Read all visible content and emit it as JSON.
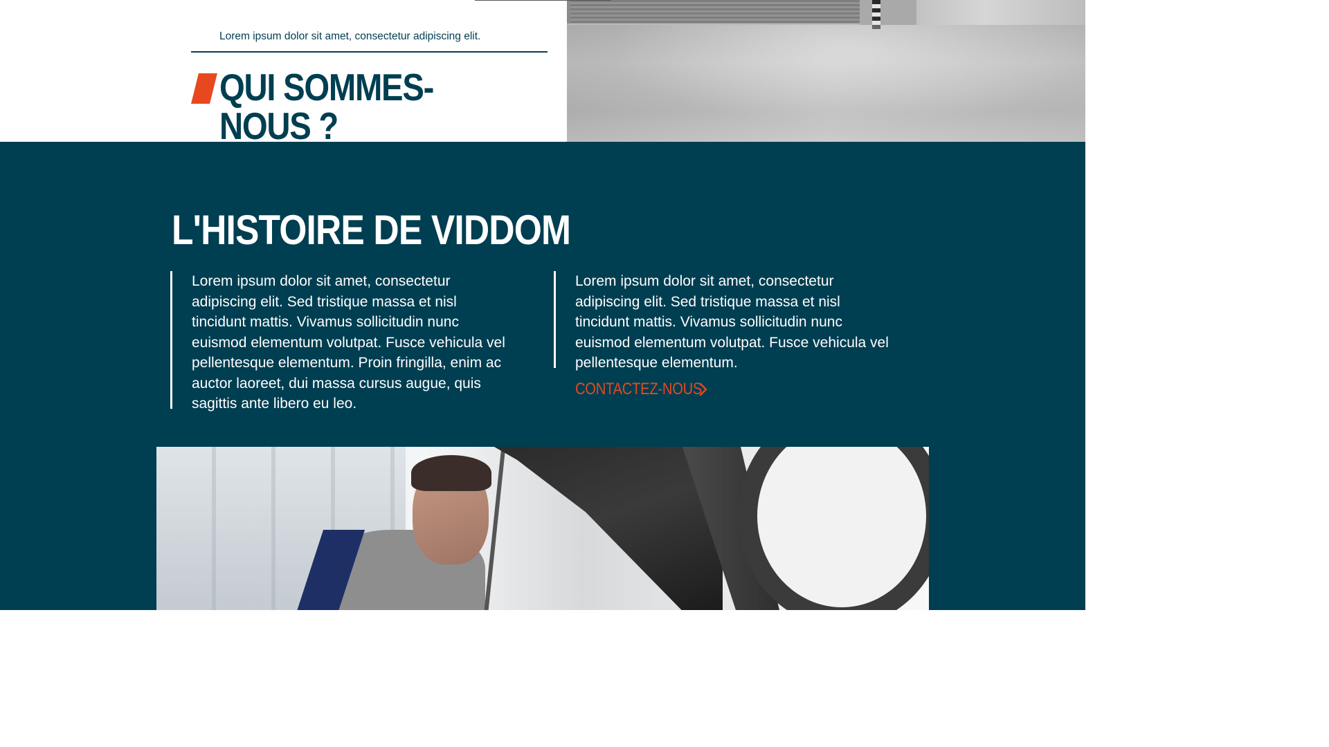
{
  "hero": {
    "tagline": "Lorem ipsum dolor sit amet, consectetur adipiscing elit.",
    "title": "QUI SOMMES-\nNOUS ?"
  },
  "story": {
    "title": "L'HISTOIRE DE VIDDOM",
    "column_1": "Lorem ipsum dolor sit amet, consectetur adipiscing elit. Sed tristique massa et nisl tincidunt mattis. Vivamus sollicitudin nunc euismod elementum volutpat. Fusce vehicula vel pellentesque elementum. Proin fringilla, enim ac auctor laoreet, dui massa cursus augue, quis sagittis ante libero eu leo.",
    "column_2": "Lorem ipsum dolor sit amet, consectetur adipiscing elit. Sed tristique massa et nisl tincidunt mattis. Vivamus sollicitudin nunc euismod elementum volutpat. Fusce vehicula vel pellentesque elementum.",
    "contact_label": "CONTACTEZ-NOUS"
  },
  "icons": {
    "contact_arrow": "chevron-right-icon",
    "title_accent": "slash-accent-icon"
  },
  "colors": {
    "brand_dark": "#003e51",
    "accent": "#e8481f",
    "text_light": "#ffffff"
  }
}
